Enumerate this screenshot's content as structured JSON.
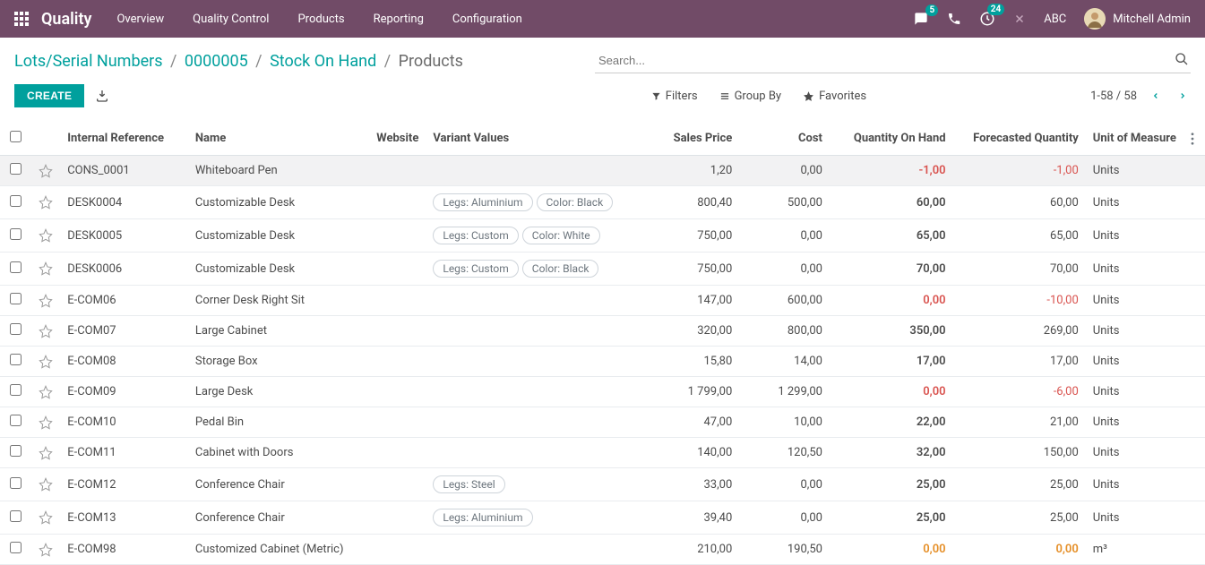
{
  "topnav": {
    "brand": "Quality",
    "menu": [
      "Overview",
      "Quality Control",
      "Products",
      "Reporting",
      "Configuration"
    ],
    "msg_badge": "5",
    "activity_badge": "24",
    "company": "ABC",
    "user": "Mitchell Admin"
  },
  "breadcrumb": {
    "parts": [
      "Lots/Serial Numbers",
      "0000005",
      "Stock On Hand"
    ],
    "current": "Products"
  },
  "search": {
    "placeholder": "Search..."
  },
  "buttons": {
    "create": "CREATE"
  },
  "tools": {
    "filters": "Filters",
    "groupby": "Group By",
    "favorites": "Favorites"
  },
  "pager": {
    "text": "1-58 / 58"
  },
  "columns": {
    "ref": "Internal Reference",
    "name": "Name",
    "website": "Website",
    "variant": "Variant Values",
    "price": "Sales Price",
    "cost": "Cost",
    "qoh": "Quantity On Hand",
    "fcast": "Forecasted Quantity",
    "uom": "Unit of Measure"
  },
  "rows": [
    {
      "ref": "CONS_0001",
      "name": "Whiteboard Pen",
      "variants": [],
      "price": "1,20",
      "cost": "0,00",
      "qoh": "-1,00",
      "qoh_neg": true,
      "fcast": "-1,00",
      "fcast_neg": true,
      "uom": "Units"
    },
    {
      "ref": "DESK0004",
      "name": "Customizable Desk",
      "variants": [
        "Legs: Aluminium",
        "Color: Black"
      ],
      "price": "800,40",
      "cost": "500,00",
      "qoh": "60,00",
      "fcast": "60,00",
      "uom": "Units"
    },
    {
      "ref": "DESK0005",
      "name": "Customizable Desk",
      "variants": [
        "Legs: Custom",
        "Color: White"
      ],
      "price": "750,00",
      "cost": "0,00",
      "qoh": "65,00",
      "fcast": "65,00",
      "uom": "Units"
    },
    {
      "ref": "DESK0006",
      "name": "Customizable Desk",
      "variants": [
        "Legs: Custom",
        "Color: Black"
      ],
      "price": "750,00",
      "cost": "0,00",
      "qoh": "70,00",
      "fcast": "70,00",
      "uom": "Units"
    },
    {
      "ref": "E-COM06",
      "name": "Corner Desk Right Sit",
      "variants": [],
      "price": "147,00",
      "cost": "600,00",
      "qoh": "0,00",
      "qoh_zero": true,
      "fcast": "-10,00",
      "fcast_neg": true,
      "uom": "Units"
    },
    {
      "ref": "E-COM07",
      "name": "Large Cabinet",
      "variants": [],
      "price": "320,00",
      "cost": "800,00",
      "qoh": "350,00",
      "fcast": "269,00",
      "uom": "Units"
    },
    {
      "ref": "E-COM08",
      "name": "Storage Box",
      "variants": [],
      "price": "15,80",
      "cost": "14,00",
      "qoh": "17,00",
      "fcast": "17,00",
      "uom": "Units"
    },
    {
      "ref": "E-COM09",
      "name": "Large Desk",
      "variants": [],
      "price": "1 799,00",
      "cost": "1 299,00",
      "qoh": "0,00",
      "qoh_zero": true,
      "fcast": "-6,00",
      "fcast_neg": true,
      "uom": "Units"
    },
    {
      "ref": "E-COM10",
      "name": "Pedal Bin",
      "variants": [],
      "price": "47,00",
      "cost": "10,00",
      "qoh": "22,00",
      "fcast": "21,00",
      "uom": "Units"
    },
    {
      "ref": "E-COM11",
      "name": "Cabinet with Doors",
      "variants": [],
      "price": "140,00",
      "cost": "120,50",
      "qoh": "32,00",
      "fcast": "150,00",
      "uom": "Units"
    },
    {
      "ref": "E-COM12",
      "name": "Conference Chair",
      "variants": [
        "Legs: Steel"
      ],
      "price": "33,00",
      "cost": "0,00",
      "qoh": "25,00",
      "fcast": "25,00",
      "uom": "Units"
    },
    {
      "ref": "E-COM13",
      "name": "Conference Chair",
      "variants": [
        "Legs: Aluminium"
      ],
      "price": "39,40",
      "cost": "0,00",
      "qoh": "25,00",
      "fcast": "25,00",
      "uom": "Units"
    },
    {
      "ref": "E-COM98",
      "name": "Customized Cabinet (Metric)",
      "variants": [],
      "price": "210,00",
      "cost": "190,50",
      "qoh": "0,00",
      "qoh_zeroF": true,
      "fcast": "0,00",
      "fcast_zeroF": true,
      "uom": "m³"
    }
  ]
}
